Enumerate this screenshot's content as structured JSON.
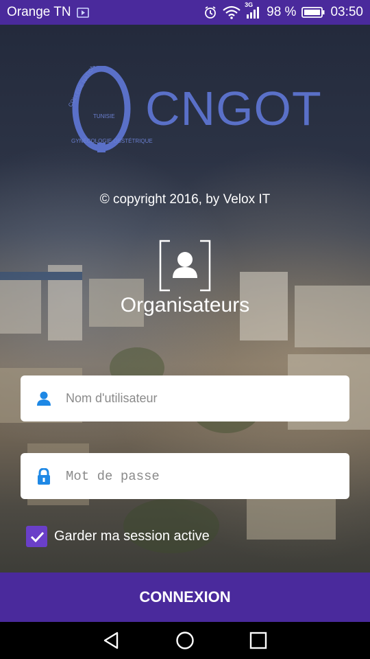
{
  "status_bar": {
    "carrier": "Orange TN",
    "network_type": "3G",
    "battery": "98 %",
    "time": "03:50",
    "icons": [
      "play-store-icon",
      "alarm-icon",
      "wifi-icon",
      "signal-icon",
      "battery-icon"
    ]
  },
  "logo": {
    "name": "CNGOT",
    "ring_top": "COLLÈGE NATIONAL",
    "ring_bottom": "GYNÉCOLOGIE OBSTÉTRIQUE",
    "ring_center": "TUNISIE"
  },
  "copyright": "© copyright 2016, by Velox IT",
  "section": {
    "icon": "user-frame-icon",
    "title": "Organisateurs"
  },
  "form": {
    "username_placeholder": "Nom d'utilisateur",
    "password_placeholder": "Mot de passe",
    "remember_label": "Garder ma session active",
    "remember_checked": true,
    "submit_label": "CONNEXION"
  },
  "nav": [
    "back-icon",
    "home-icon",
    "recents-icon"
  ],
  "colors": {
    "primary": "#4a2a9c",
    "checkbox": "#6a3fc8",
    "icon_blue": "#1e88e5",
    "logo_blue": "#5a70c8"
  }
}
